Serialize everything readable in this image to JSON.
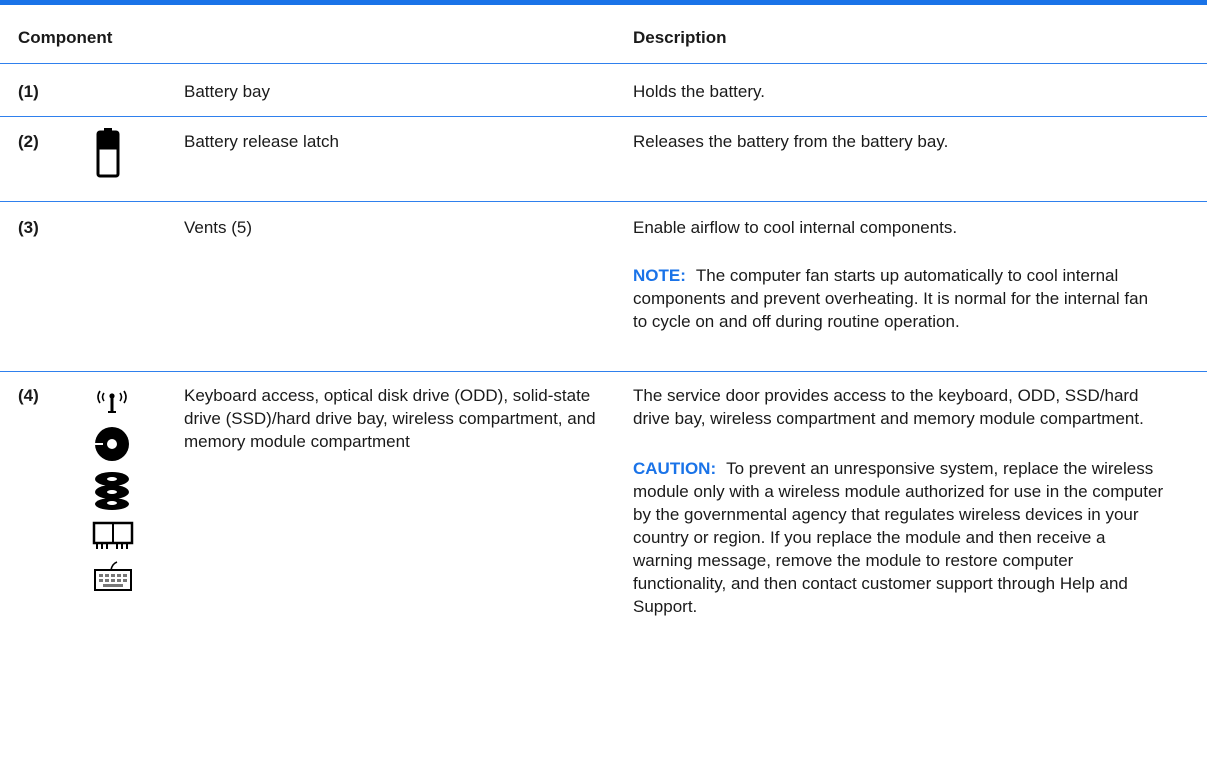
{
  "header": {
    "component": "Component",
    "description": "Description"
  },
  "rows": [
    {
      "num": "(1)",
      "name": "Battery bay",
      "desc": "Holds the battery."
    },
    {
      "num": "(2)",
      "name": "Battery release latch",
      "desc": "Releases the battery from the battery bay.",
      "icon": "battery-icon"
    },
    {
      "num": "(3)",
      "name": "Vents (5)",
      "desc": "Enable airflow to cool internal components.",
      "note_label": "NOTE:",
      "note_text": "The computer fan starts up automatically to cool internal components and prevent overheating. It is normal for the internal fan to cycle on and off during routine operation."
    },
    {
      "num": "(4)",
      "name": "Keyboard access, optical disk drive (ODD), solid-state drive (SSD)/hard drive bay, wireless compartment, and memory module compartment",
      "desc": "The service door provides access to the keyboard, ODD, SSD/hard drive bay, wireless compartment and memory module compartment.",
      "note_label": "CAUTION:",
      "note_text": "To prevent an unresponsive system, replace the wireless module only with a wireless module authorized for use in the computer by the governmental agency that regulates wireless devices in your country or region. If you replace the module and then receive a warning message, remove the module to restore computer functionality, and then contact customer support through Help and Support.",
      "icons": [
        "wireless-icon",
        "optical-disc-icon",
        "hard-drive-icon",
        "memory-module-icon",
        "keyboard-icon"
      ]
    }
  ],
  "colors": {
    "rule": "#2f80ed",
    "accent": "#1a73e8"
  }
}
